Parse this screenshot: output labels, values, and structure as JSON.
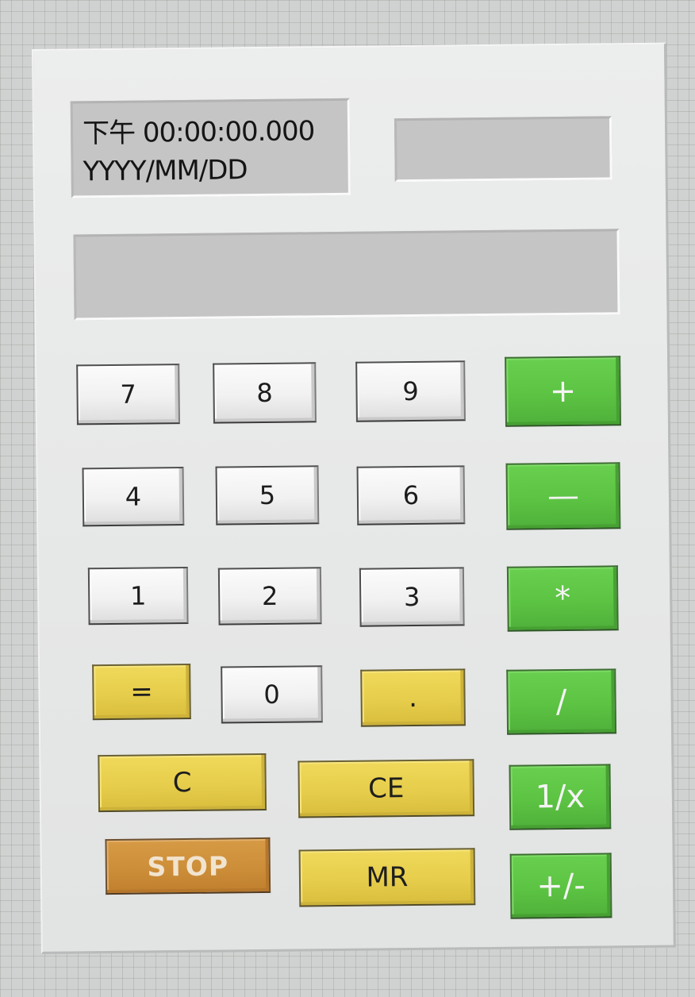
{
  "clock": {
    "time": "下午 00:00:00.000",
    "date": "YYYY/MM/DD"
  },
  "aux_display": {
    "value": ""
  },
  "main_display": {
    "value": ""
  },
  "keys": {
    "seven": "7",
    "eight": "8",
    "nine": "9",
    "plus": "+",
    "four": "4",
    "five": "5",
    "six": "6",
    "minus": "—",
    "one": "1",
    "two": "2",
    "three": "3",
    "multiply": "*",
    "equals": "=",
    "zero": "0",
    "decimal": ".",
    "divide": "/",
    "clear": "C",
    "clear_entry": "CE",
    "reciprocal": "1/x",
    "stop": "STOP",
    "memory_recall": "MR",
    "negate": "+/-"
  },
  "colors": {
    "number_key": "#f1f1f1",
    "operator_key": "#5cc343",
    "function_key": "#e6cd4b",
    "stop_key": "#cd8e39",
    "display": "#c6c5c6",
    "panel": "#e6e7e7"
  }
}
